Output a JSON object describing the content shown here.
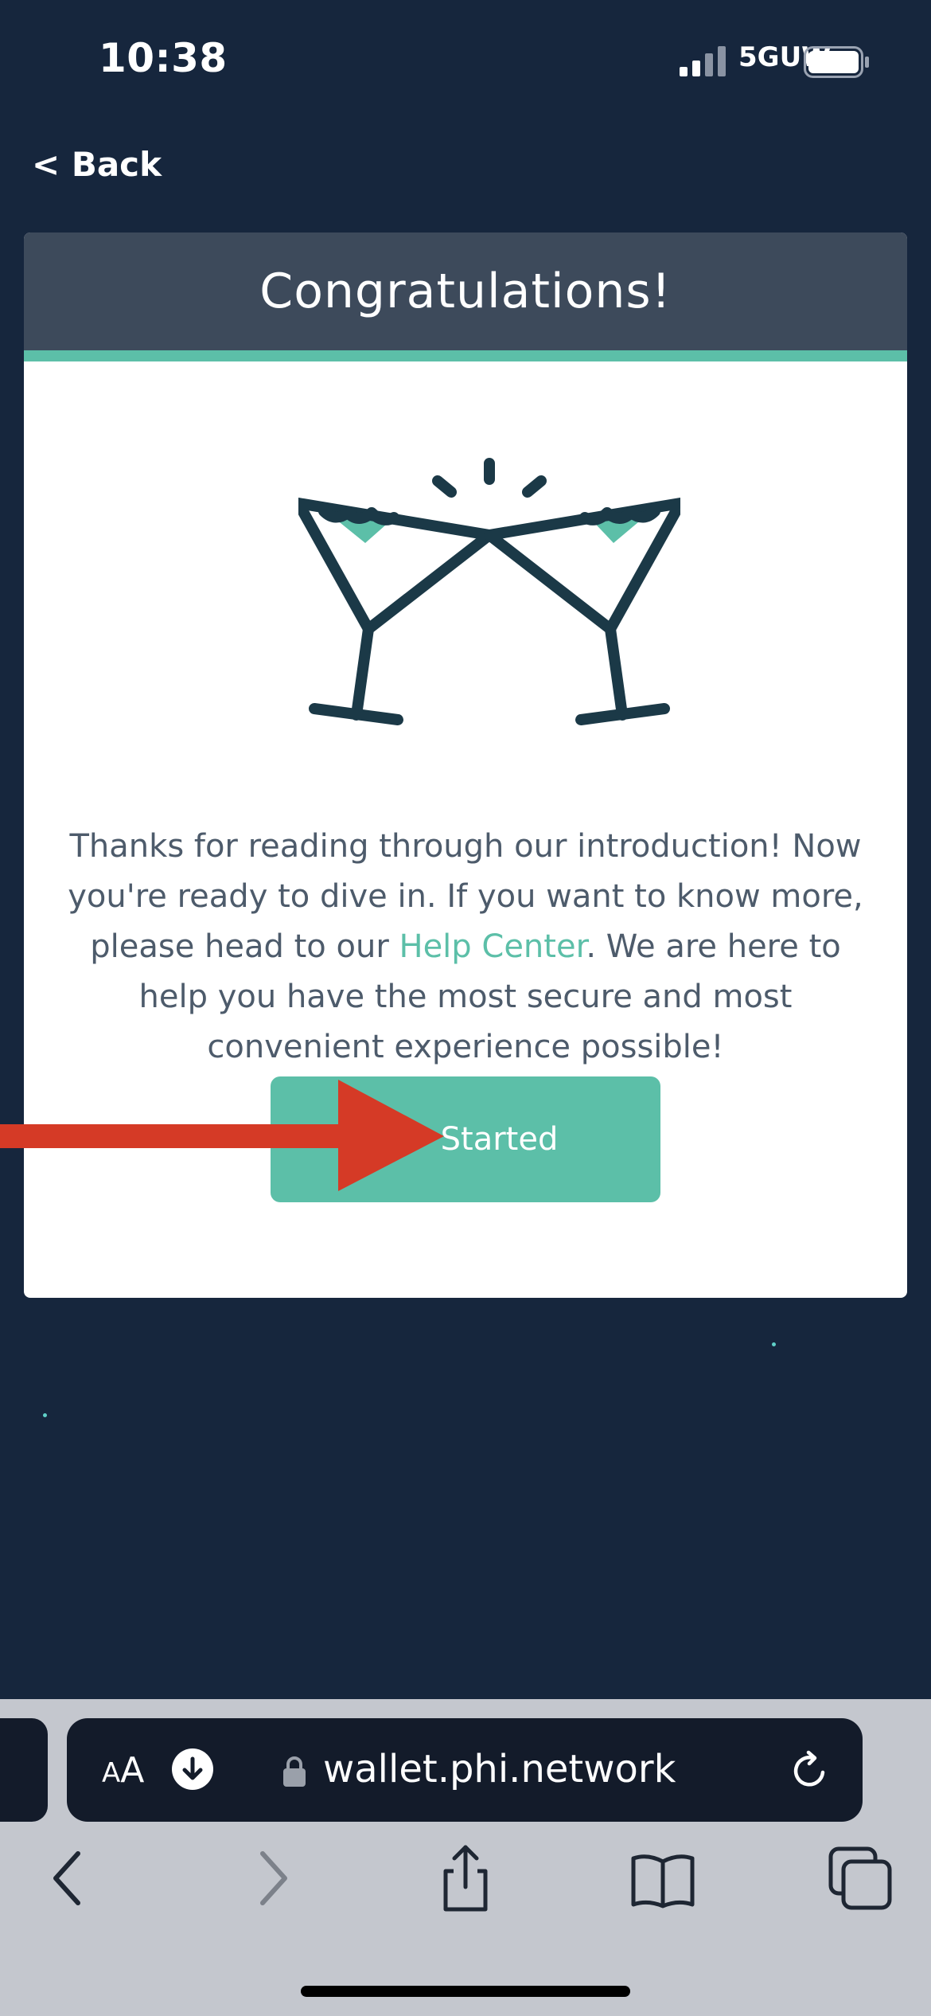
{
  "status_bar": {
    "time": "10:38",
    "network": "5GUW"
  },
  "header": {
    "back_label": "< Back"
  },
  "card": {
    "title": "Congratulations!",
    "message_before_link": "Thanks for reading through our introduction! Now you're ready to dive in. If you want to know more, please head to our ",
    "link_text": "Help Center",
    "message_after_link": ". We are here to help you have the most secure and most convenient experience possible!",
    "button_label": "Started"
  },
  "browser": {
    "text_size_label_small": "A",
    "text_size_label_large": "A",
    "url": "wallet.phi.network"
  },
  "icons": {
    "cheers": "cheers-glasses-icon",
    "arrow": "red-pointer-arrow",
    "download": "download-circle-icon",
    "lock": "lock-icon",
    "reload": "reload-icon",
    "back": "chevron-left-icon",
    "forward": "chevron-right-icon",
    "share": "share-icon",
    "bookmarks": "book-icon",
    "tabs": "tabs-icon"
  },
  "colors": {
    "background": "#16263d",
    "accent": "#5cbfa8",
    "header": "#3d4a5b",
    "arrow": "#d53a26",
    "icon_dark": "#1b3947"
  }
}
